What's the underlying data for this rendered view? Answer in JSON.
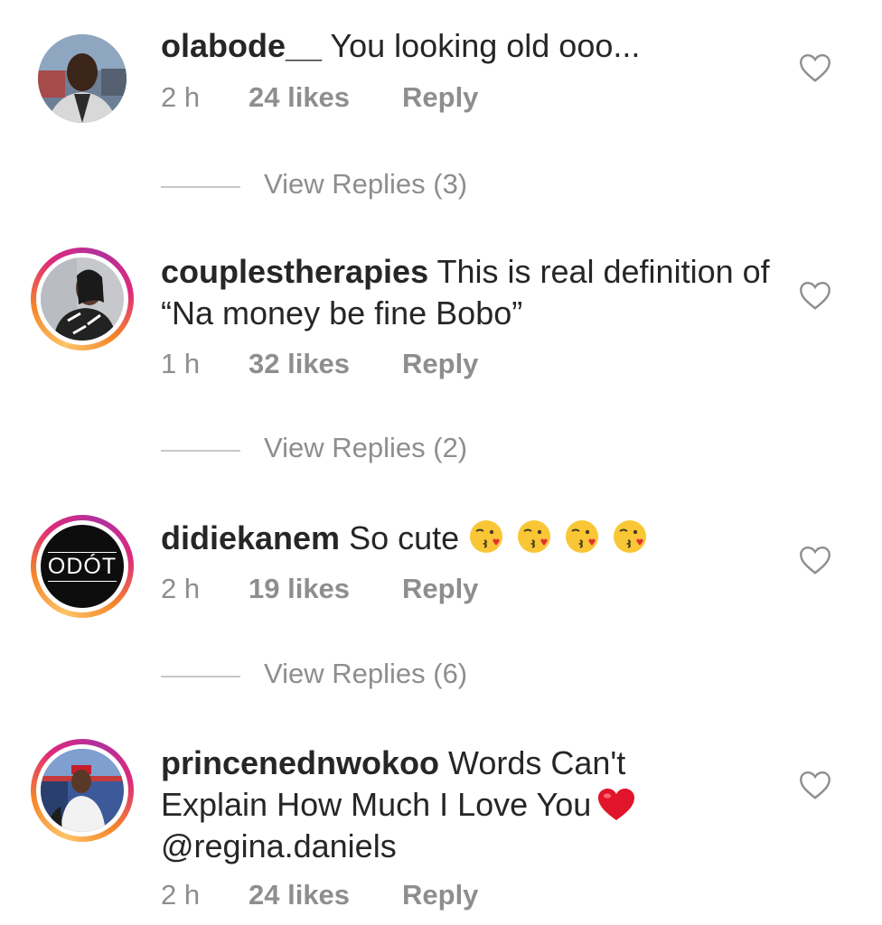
{
  "comments": [
    {
      "username": "olabode__",
      "text": " You looking old ooo...",
      "time": "2 h",
      "likes": "24 likes",
      "reply": "Reply",
      "view_replies": "View Replies (3)"
    },
    {
      "username": "couplestherapies",
      "text": " This is real definition of “Na money be fine Bobo”",
      "time": "1 h",
      "likes": "32 likes",
      "reply": "Reply",
      "view_replies": "View Replies (2)"
    },
    {
      "username": "didiekanem",
      "text": " So cute",
      "emoji": "kissing-face-with-heart-emoji",
      "emoji_count": 4,
      "avatar_text": "ODÓT",
      "time": "2 h",
      "likes": "19 likes",
      "reply": "Reply",
      "view_replies": "View Replies (6)"
    },
    {
      "username": "princenednwokoo",
      "text_before": " Words Can't Explain How Much I Love You",
      "text_after": "@regina.daniels",
      "emoji": "red-heart-emoji",
      "time": "2 h",
      "likes": "24 likes",
      "reply": "Reply"
    }
  ],
  "colors": {
    "text": "#262626",
    "meta": "#8e8e8e",
    "story_ring_start": "#fdc468",
    "story_ring_end": "#b1309c",
    "heart": "#e0245e"
  },
  "icons": {
    "like": "heart-outline-icon"
  }
}
